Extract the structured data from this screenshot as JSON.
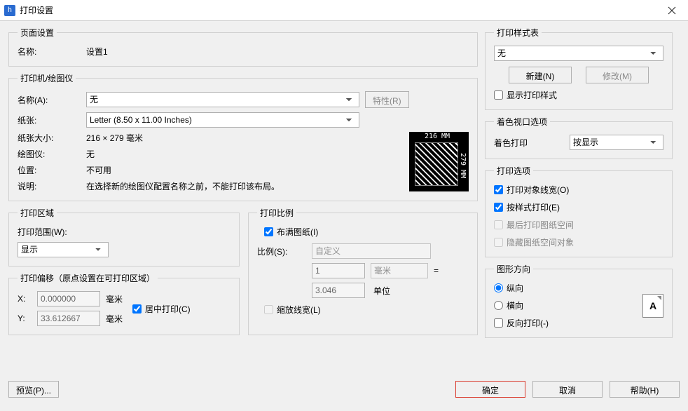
{
  "title": "打印设置",
  "pageSetup": {
    "legend": "页面设置",
    "nameLabel": "名称:",
    "nameValue": "设置1"
  },
  "printer": {
    "legend": "打印机/绘图仪",
    "nameLabel": "名称(A):",
    "nameValue": "无",
    "propsBtn": "特性(R)",
    "paperLabel": "纸张:",
    "paperValue": "Letter (8.50 x 11.00 Inches)",
    "sizeLabel": "纸张大小:",
    "sizeValue": "216 × 279 毫米",
    "plotterLabel": "绘图仪:",
    "plotterValue": "无",
    "whereLabel": "位置:",
    "whereValue": "不可用",
    "descLabel": "说明:",
    "descValue": "在选择新的绘图仪配置名称之前，不能打印该布局。",
    "thumbTop": "216 MM",
    "thumbSide": "279 MM"
  },
  "printArea": {
    "legend": "打印区域",
    "rangeLabel": "打印范围(W):",
    "rangeValue": "显示"
  },
  "printOffset": {
    "legend": "打印偏移（原点设置在可打印区域）",
    "xLabel": "X:",
    "xValue": "0.000000",
    "yLabel": "Y:",
    "yValue": "33.612667",
    "unit": "毫米",
    "centerLabel": "居中打印(C)"
  },
  "printScale": {
    "legend": "打印比例",
    "fitLabel": "布满图纸(I)",
    "scaleLabel": "比例(S):",
    "scaleValue": "自定义",
    "unitTop": "1",
    "unitTopUnit": "毫米",
    "eq": "=",
    "unitBottom": "3.046",
    "unitBottomUnit": "单位",
    "scaleLwLabel": "缩放线宽(L)"
  },
  "styleTable": {
    "legend": "打印样式表",
    "value": "无",
    "newBtn": "新建(N)",
    "modifyBtn": "修改(M)",
    "displayStyleLabel": "显示打印样式"
  },
  "shadeView": {
    "legend": "着色视口选项",
    "shadeLabel": "着色打印",
    "shadeValue": "按显示"
  },
  "printOpts": {
    "legend": "打印选项",
    "lw": "打印对象线宽(O)",
    "byStyle": "按样式打印(E)",
    "lastSpace": "最后打印图纸空间",
    "hideSpace": "隐藏图纸空间对象"
  },
  "orientation": {
    "legend": "图形方向",
    "portrait": "纵向",
    "landscape": "横向",
    "reverse": "反向打印(-)",
    "glyph": "A"
  },
  "bottom": {
    "preview": "预览(P)...",
    "ok": "确定",
    "cancel": "取消",
    "help": "帮助(H)"
  }
}
